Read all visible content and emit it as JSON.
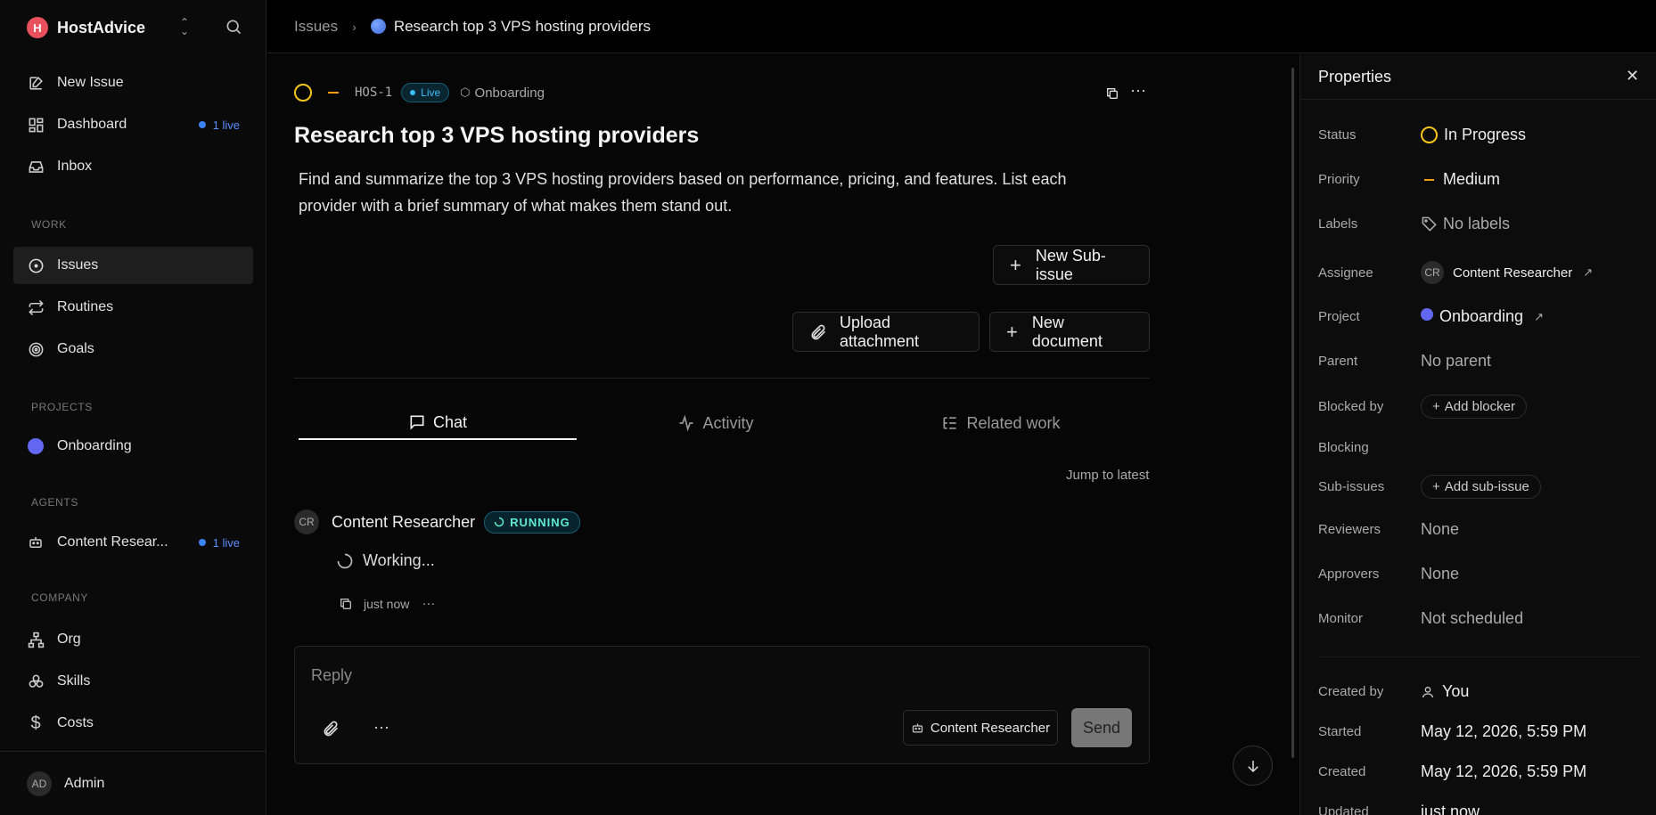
{
  "sidebar": {
    "brand": {
      "name": "HostAdvice",
      "logo_letter": "H"
    },
    "nav": [
      {
        "label": "New Issue",
        "icon": "edit-icon"
      },
      {
        "label": "Dashboard",
        "icon": "dashboard-icon",
        "live": "1 live"
      },
      {
        "label": "Inbox",
        "icon": "inbox-icon"
      }
    ],
    "work_label": "WORK",
    "work": [
      {
        "label": "Issues",
        "icon": "circle-dot-icon",
        "active": true
      },
      {
        "label": "Routines",
        "icon": "repeat-icon"
      },
      {
        "label": "Goals",
        "icon": "target-icon"
      }
    ],
    "projects_label": "PROJECTS",
    "projects": [
      {
        "label": "Onboarding",
        "color": "#6366f1"
      }
    ],
    "agents_label": "AGENTS",
    "agents": [
      {
        "label": "Content Resear...",
        "live": "1 live",
        "icon": "bot-icon"
      }
    ],
    "company_label": "COMPANY",
    "company": [
      {
        "label": "Org",
        "icon": "org-icon"
      },
      {
        "label": "Skills",
        "icon": "skills-icon"
      },
      {
        "label": "Costs",
        "icon": "dollar-icon"
      }
    ],
    "user": {
      "initials": "AD",
      "name": "Admin"
    }
  },
  "breadcrumb": {
    "root": "Issues",
    "current": "Research top 3 VPS hosting providers"
  },
  "issue": {
    "id": "HOS-1",
    "live_label": "Live",
    "project": "Onboarding",
    "title": "Research top 3 VPS hosting providers",
    "description": "Find and summarize the top 3 VPS hosting providers based on performance, pricing, and features. List each provider with a brief summary of what makes them stand out.",
    "new_subissue": "New Sub-issue",
    "upload_attachment": "Upload attachment",
    "new_document": "New document"
  },
  "tabs": [
    {
      "label": "Chat",
      "icon": "chat-icon",
      "active": true
    },
    {
      "label": "Activity",
      "icon": "activity-icon"
    },
    {
      "label": "Related work",
      "icon": "list-tree-icon"
    }
  ],
  "chat": {
    "jump_to_latest": "Jump to latest",
    "author_initials": "CR",
    "author": "Content Researcher",
    "status": "RUNNING",
    "working_text": "Working...",
    "timestamp": "just now"
  },
  "composer": {
    "placeholder": "Reply",
    "agent": "Content Researcher",
    "send": "Send"
  },
  "properties": {
    "title": "Properties",
    "status": {
      "label": "Status",
      "value": "In Progress",
      "color": "#f5c518"
    },
    "priority": {
      "label": "Priority",
      "value": "Medium",
      "color": "#f59e0b"
    },
    "labels": {
      "label": "Labels",
      "value": "No labels"
    },
    "assignee": {
      "label": "Assignee",
      "initials": "CR",
      "value": "Content Researcher"
    },
    "project": {
      "label": "Project",
      "value": "Onboarding",
      "color": "#6366f1"
    },
    "parent": {
      "label": "Parent",
      "value": "No parent"
    },
    "blocked_by": {
      "label": "Blocked by",
      "action": "Add blocker"
    },
    "blocking": {
      "label": "Blocking"
    },
    "sub_issues": {
      "label": "Sub-issues",
      "action": "Add sub-issue"
    },
    "reviewers": {
      "label": "Reviewers",
      "value": "None"
    },
    "approvers": {
      "label": "Approvers",
      "value": "None"
    },
    "monitor": {
      "label": "Monitor",
      "value": "Not scheduled"
    },
    "created_by": {
      "label": "Created by",
      "value": "You"
    },
    "started": {
      "label": "Started",
      "value": "May 12, 2026, 5:59 PM"
    },
    "created": {
      "label": "Created",
      "value": "May 12, 2026, 5:59 PM"
    },
    "updated": {
      "label": "Updated",
      "value": "just now"
    }
  }
}
